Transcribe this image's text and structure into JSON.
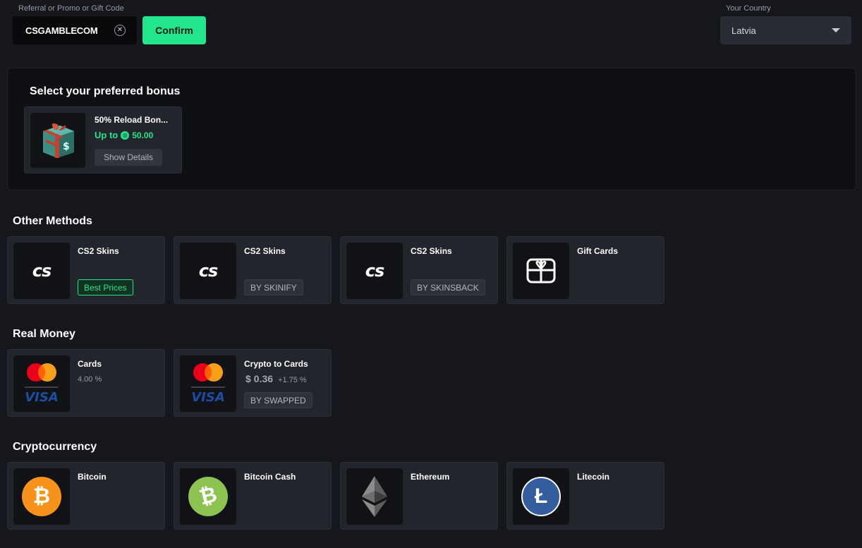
{
  "promo": {
    "label": "Referral or Promo or Gift Code",
    "value": "CSGAMBLECOM",
    "confirm_label": "Confirm"
  },
  "country": {
    "label": "Your Country",
    "value": "Latvia"
  },
  "bonus": {
    "title": "Select your preferred bonus",
    "card": {
      "name": "50% Reload Bon...",
      "up_to_label": "Up to",
      "amount": "50.00",
      "details_label": "Show Details"
    }
  },
  "other_methods": {
    "title": "Other Methods",
    "items": [
      {
        "name": "CS2 Skins",
        "tag": "Best Prices",
        "icon": "cs2-logo-icon"
      },
      {
        "name": "CS2 Skins",
        "tag": "BY SKINIFY",
        "icon": "cs2-logo-icon"
      },
      {
        "name": "CS2 Skins",
        "tag": "BY SKINSBACK",
        "icon": "cs2-logo-icon"
      },
      {
        "name": "Gift Cards",
        "icon": "gift-card-icon"
      }
    ]
  },
  "real_money": {
    "title": "Real Money",
    "items": [
      {
        "name": "Cards",
        "fee": "4.00 %",
        "icon": "mastercard-visa-icon"
      },
      {
        "name": "Crypto to Cards",
        "price_symbol": "$",
        "price": "0.36",
        "fee": "+1.75 %",
        "tag": "BY SWAPPED",
        "icon": "mastercard-visa-icon"
      }
    ]
  },
  "crypto": {
    "title": "Cryptocurrency",
    "items": [
      {
        "name": "Bitcoin",
        "icon": "bitcoin-icon",
        "color": "#f7931a"
      },
      {
        "name": "Bitcoin Cash",
        "icon": "bitcoin-cash-icon",
        "color": "#8dc351"
      },
      {
        "name": "Ethereum",
        "icon": "ethereum-icon",
        "color": "#3c3c3d"
      },
      {
        "name": "Litecoin",
        "icon": "litecoin-icon",
        "color": "#345d9d"
      }
    ]
  },
  "colors": {
    "accent": "#22e58c",
    "background": "#16171c",
    "card": "#23252c"
  }
}
